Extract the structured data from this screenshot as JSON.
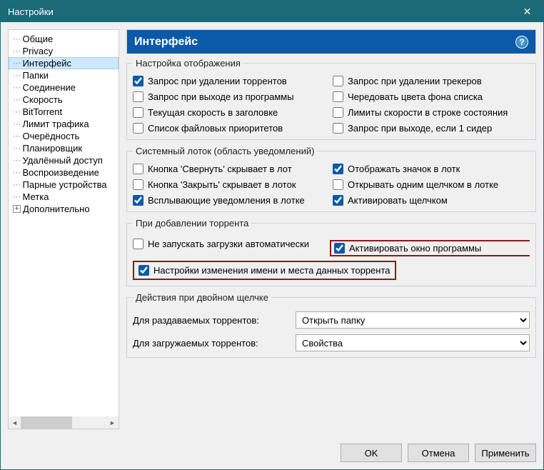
{
  "window": {
    "title": "Настройки",
    "close": "✕"
  },
  "sidebar": {
    "items": [
      {
        "label": "Общие"
      },
      {
        "label": "Privacy"
      },
      {
        "label": "Интерфейс",
        "selected": true
      },
      {
        "label": "Папки"
      },
      {
        "label": "Соединение"
      },
      {
        "label": "Скорость"
      },
      {
        "label": "BitTorrent"
      },
      {
        "label": "Лимит трафика"
      },
      {
        "label": "Очерёдность"
      },
      {
        "label": "Планировщик"
      },
      {
        "label": "Удалённый доступ"
      },
      {
        "label": "Воспроизведение"
      },
      {
        "label": "Парные устройства"
      },
      {
        "label": "Метка"
      },
      {
        "label": "Дополнительно",
        "expandable": true
      }
    ]
  },
  "header": {
    "title": "Интерфейс"
  },
  "groups": {
    "display": {
      "legend": "Настройка отображения",
      "left": [
        {
          "label": "Запрос при удалении торрентов",
          "checked": true
        },
        {
          "label": "Запрос при выходе из программы",
          "checked": false
        },
        {
          "label": "Текущая скорость в заголовке",
          "checked": false
        },
        {
          "label": "Список файловых приоритетов",
          "checked": false
        }
      ],
      "right": [
        {
          "label": "Запрос при удалении трекеров",
          "checked": false
        },
        {
          "label": "Чередовать цвета фона списка",
          "checked": false
        },
        {
          "label": "Лимиты скорости в строке состояния",
          "checked": false
        },
        {
          "label": "Запрос при выходе, если 1 сидер",
          "checked": false
        }
      ]
    },
    "tray": {
      "legend": "Системный лоток (область уведомлений)",
      "left": [
        {
          "label": "Кнопка 'Свернуть' скрывает в лот",
          "checked": false
        },
        {
          "label": "Кнопка 'Закрыть' скрывает в лоток",
          "checked": false
        },
        {
          "label": "Всплывающие уведомления в лотке",
          "checked": true
        }
      ],
      "right": [
        {
          "label": "Отображать значок в лотк",
          "checked": true
        },
        {
          "label": "Открывать одним щелчком в лотке",
          "checked": false
        },
        {
          "label": "Активировать щелчком",
          "checked": true
        }
      ]
    },
    "adding": {
      "legend": "При добавлении торрента",
      "top": {
        "left": {
          "label": "Не запускать загрузки автоматически",
          "checked": false
        },
        "right": {
          "label": "Активировать окно программы",
          "checked": true
        }
      },
      "bottom": {
        "label": "Настройки изменения имени и места данных торрента",
        "checked": true
      }
    },
    "dblclick": {
      "legend": "Действия при двойном щелчке",
      "rows": [
        {
          "label": "Для раздаваемых торрентов:",
          "value": "Открыть папку"
        },
        {
          "label": "Для загружаемых торрентов:",
          "value": "Свойства"
        }
      ]
    }
  },
  "footer": {
    "ok": "OK",
    "cancel": "Отмена",
    "apply": "Применить"
  }
}
